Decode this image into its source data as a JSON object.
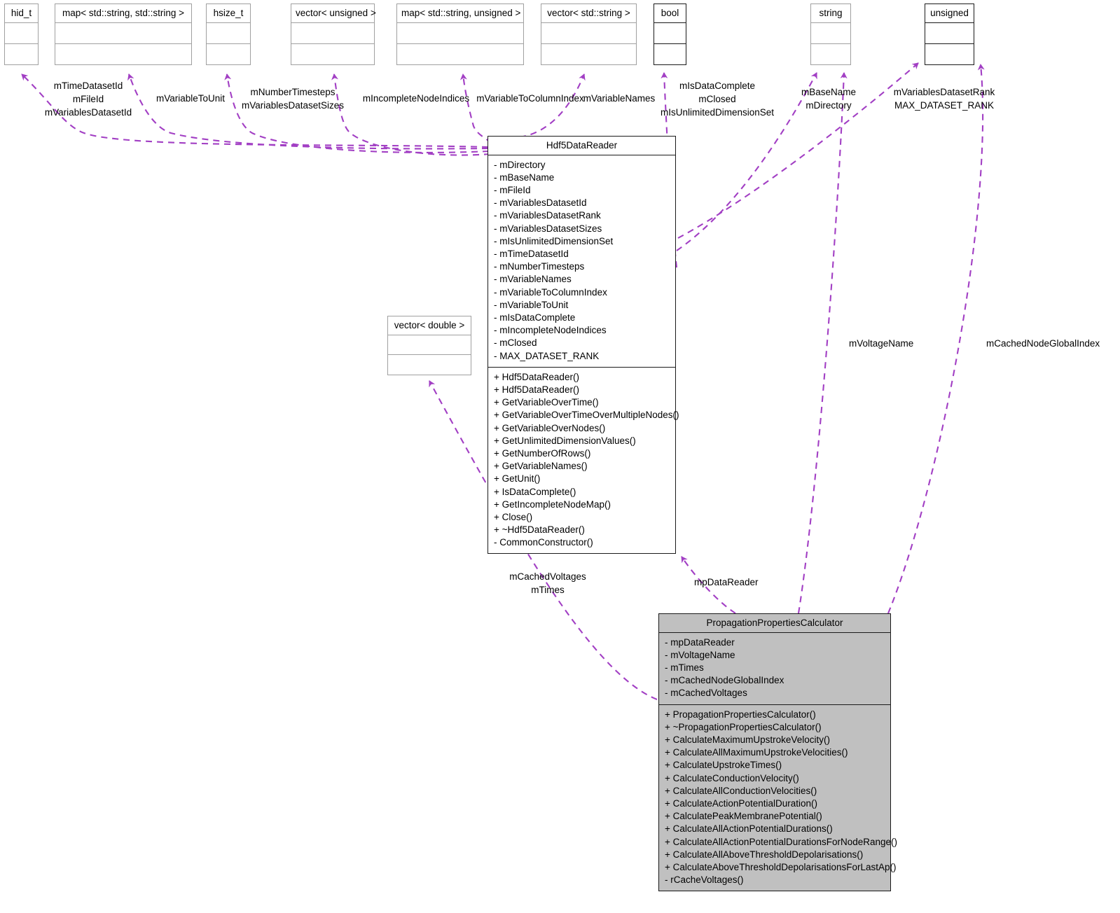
{
  "diagram": {
    "type": "uml-class-collaboration-diagram",
    "accent_color": "#a23fc4",
    "edge_style": "dashed"
  },
  "nodes": {
    "hid_t": {
      "title": "hid_t",
      "style": "plain"
    },
    "map_str_str": {
      "title": "map< std::string, std::string >",
      "style": "plain"
    },
    "hsize_t": {
      "title": "hsize_t",
      "style": "plain"
    },
    "vector_unsigned": {
      "title": "vector< unsigned >",
      "style": "plain"
    },
    "map_str_unsigned": {
      "title": "map< std::string, unsigned >",
      "style": "plain"
    },
    "vector_string": {
      "title": "vector< std::string >",
      "style": "plain"
    },
    "bool": {
      "title": "bool",
      "style": "strong"
    },
    "string": {
      "title": "string",
      "style": "plain"
    },
    "unsigned": {
      "title": "unsigned",
      "style": "strong"
    },
    "vector_double": {
      "title": "vector< double >",
      "style": "plain"
    }
  },
  "hdf5_data_reader": {
    "title": "Hdf5DataReader",
    "attributes": [
      "- mDirectory",
      "- mBaseName",
      "- mFileId",
      "- mVariablesDatasetId",
      "- mVariablesDatasetRank",
      "- mVariablesDatasetSizes",
      "- mIsUnlimitedDimensionSet",
      "- mTimeDatasetId",
      "- mNumberTimesteps",
      "- mVariableNames",
      "- mVariableToColumnIndex",
      "- mVariableToUnit",
      "- mIsDataComplete",
      "- mIncompleteNodeIndices",
      "- mClosed",
      "- MAX_DATASET_RANK"
    ],
    "operations": [
      "+ Hdf5DataReader()",
      "+ Hdf5DataReader()",
      "+ GetVariableOverTime()",
      "+ GetVariableOverTimeOverMultipleNodes()",
      "+ GetVariableOverNodes()",
      "+ GetUnlimitedDimensionValues()",
      "+ GetNumberOfRows()",
      "+ GetVariableNames()",
      "+ GetUnit()",
      "+ IsDataComplete()",
      "+ GetIncompleteNodeMap()",
      "+ Close()",
      "+ ~Hdf5DataReader()",
      "- CommonConstructor()"
    ]
  },
  "propagation_properties_calculator": {
    "title": "PropagationPropertiesCalculator",
    "attributes": [
      "- mpDataReader",
      "- mVoltageName",
      "- mTimes",
      "- mCachedNodeGlobalIndex",
      "- mCachedVoltages"
    ],
    "operations": [
      "+ PropagationPropertiesCalculator()",
      "+ ~PropagationPropertiesCalculator()",
      "+ CalculateMaximumUpstrokeVelocity()",
      "+ CalculateAllMaximumUpstrokeVelocities()",
      "+ CalculateUpstrokeTimes()",
      "+ CalculateConductionVelocity()",
      "+ CalculateAllConductionVelocities()",
      "+ CalculateActionPotentialDuration()",
      "+ CalculatePeakMembranePotential()",
      "+ CalculateAllActionPotentialDurations()",
      "+ CalculateAllActionPotentialDurationsForNodeRange()",
      "+ CalculateAllAboveThresholdDepolarisations()",
      "+ CalculateAboveThresholdDepolarisationsForLastAp()",
      "- rCacheVoltages()"
    ]
  },
  "edge_labels": {
    "hid_t_members": "mTimeDatasetId\nmFileId\nmVariablesDatasetId",
    "map_str_str_members": "mVariableToUnit",
    "hsize_t_members": "mNumberTimesteps\nmVariablesDatasetSizes",
    "vector_unsigned_members": "mIncompleteNodeIndices",
    "map_str_unsigned_members": "mVariableToColumnIndex",
    "vector_string_members": "mVariableNames",
    "bool_members": "mIsDataComplete\nmClosed\nmIsUnlimitedDimensionSet",
    "string_members": "mBaseName\nmDirectory",
    "unsigned_members": "mVariablesDatasetRank\nMAX_DATASET_RANK",
    "vector_double_members": "mCachedVoltages\nmTimes",
    "mp_data_reader": "mpDataReader",
    "m_voltage_name": "mVoltageName",
    "m_cached_node_global_index": "mCachedNodeGlobalIndex"
  }
}
